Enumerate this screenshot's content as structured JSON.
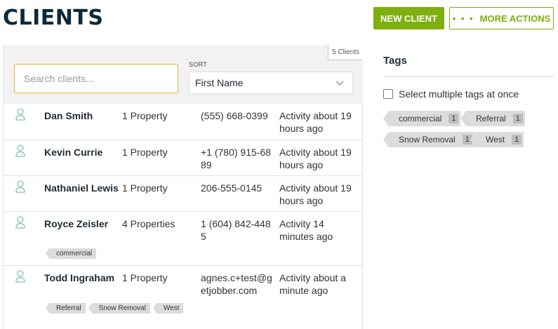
{
  "header": {
    "title": "CLIENTS",
    "new_client_label": "NEW CLIENT",
    "more_actions_dots": "• • •",
    "more_actions_label": "MORE ACTIONS"
  },
  "filters": {
    "count_badge": "5 Clients",
    "search_placeholder": "Search clients...",
    "sort_label": "SORT",
    "sort_value": "First Name"
  },
  "clients": [
    {
      "name": "Dan Smith",
      "properties": "1 Property",
      "phone": "(555) 668-0399",
      "activity": "Activity about 19 hours ago",
      "tags": []
    },
    {
      "name": "Kevin Currie",
      "properties": "1 Property",
      "phone": "+1 (780) 915-6889",
      "activity": "Activity about 19 hours ago",
      "tags": []
    },
    {
      "name": "Nathaniel Lewis",
      "properties": "1 Property",
      "phone": "206-555-0145",
      "activity": "Activity about 19 hours ago",
      "tags": []
    },
    {
      "name": "Royce Zeisler",
      "properties": "4 Properties",
      "phone": "1 (604) 842-4485",
      "activity": "Activity 14 minutes ago",
      "tags": [
        "commercial"
      ]
    },
    {
      "name": "Todd Ingraham",
      "properties": "1 Property",
      "phone": "agnes.c+test@getjobber.com",
      "activity": "Activity about a minute ago",
      "tags": [
        "Referral",
        "Snow Removal",
        "West"
      ]
    }
  ],
  "tags_panel": {
    "title": "Tags",
    "multi_select_label": "Select multiple tags at once",
    "tags": [
      {
        "label": "commercial",
        "count": "1"
      },
      {
        "label": "Referral",
        "count": "1"
      },
      {
        "label": "Snow Removal",
        "count": "1"
      },
      {
        "label": "West",
        "count": "1"
      }
    ]
  },
  "colors": {
    "accent": "#7db00e",
    "title": "#0e2a3a",
    "avatar": "#7ec8a0",
    "search_border": "#e3b43a"
  }
}
